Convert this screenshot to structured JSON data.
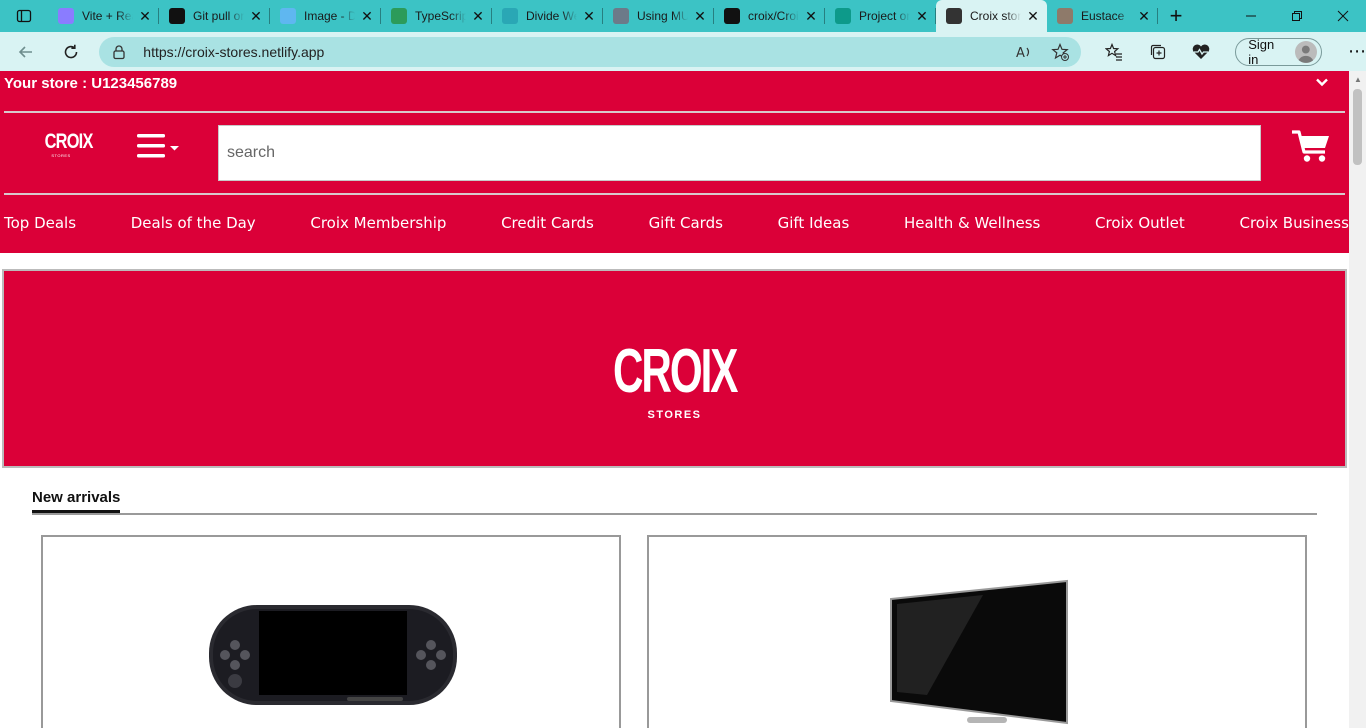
{
  "browser": {
    "tabs": [
      {
        "title": "Vite + React",
        "icon": "vite-icon",
        "color": "#8a7cff"
      },
      {
        "title": "Git pull origin",
        "icon": "chatgpt-icon",
        "color": "#111111"
      },
      {
        "title": "Image - Discord",
        "icon": "lightning-icon",
        "color": "#5fb7f0"
      },
      {
        "title": "TypeScript",
        "icon": "w3-icon",
        "color": "#2c9b5a"
      },
      {
        "title": "Divide Web",
        "icon": "web-icon",
        "color": "#2aa7b5"
      },
      {
        "title": "Using MUI",
        "icon": "doc-icon",
        "color": "#6c7a89"
      },
      {
        "title": "croix/Croix",
        "icon": "github-icon",
        "color": "#111111"
      },
      {
        "title": "Project on",
        "icon": "diamond-icon",
        "color": "#0d9a8a"
      },
      {
        "title": "Croix stores",
        "icon": "page-icon",
        "color": "#333333",
        "active": true
      },
      {
        "title": "Eustace",
        "icon": "vue-icon",
        "color": "#8e7a6a"
      }
    ],
    "url": "https://croix-stores.netlify.app",
    "signin_label": "Sign in"
  },
  "site": {
    "brand_color": "#db0038",
    "store_prefix": "Your store : ",
    "store_id": "U123456789",
    "logo_word": "CROIX",
    "logo_sub": "STORES",
    "search_placeholder": "search",
    "categories": [
      "Top Deals",
      "Deals of the Day",
      "Croix Membership",
      "Credit Cards",
      "Gift Cards",
      "Gift Ideas",
      "Health & Wellness",
      "Croix Outlet",
      "Croix Business"
    ],
    "banner_word": "CROIX",
    "banner_sub": "STORES",
    "section_title": "New arrivals",
    "products": [
      {
        "name": "handheld-console",
        "icon": "psp-image"
      },
      {
        "name": "flat-tv",
        "icon": "tv-image"
      }
    ]
  }
}
